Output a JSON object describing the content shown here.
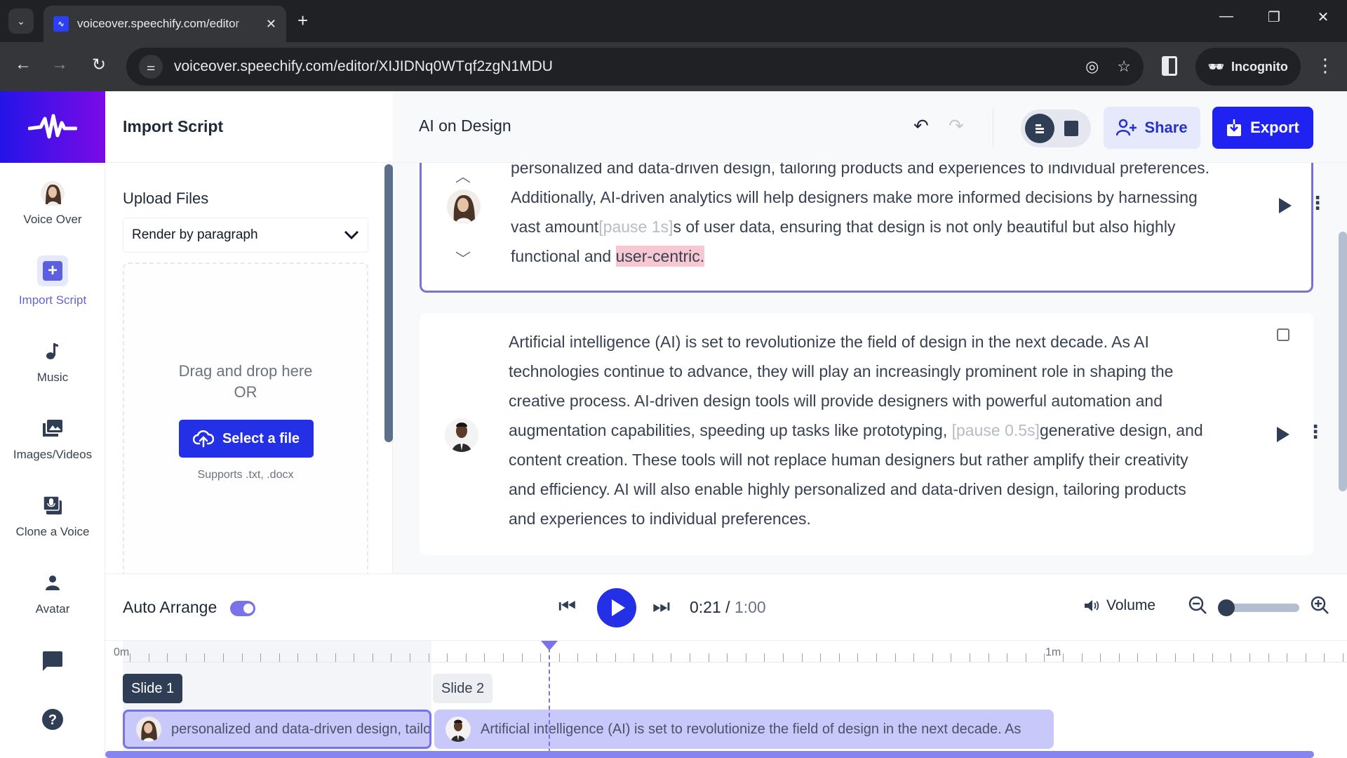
{
  "browser": {
    "tab_title": "voiceover.speechify.com/editor",
    "url": "voiceover.speechify.com/editor/XIJIDNq0WTqf2zgN1MDU",
    "profile_label": "Incognito",
    "icons": {
      "tab_search": "chevron-down-icon",
      "tab_close": "close-icon",
      "new_tab": "plus-icon",
      "back": "arrow-left-icon",
      "forward": "arrow-right-icon",
      "reload": "reload-icon",
      "site_info": "tune-icon",
      "tracking": "eye-off-icon",
      "bookmark": "star-icon",
      "side_panel": "side-panel-icon",
      "incognito": "incognito-icon",
      "menu": "more-vertical-icon"
    }
  },
  "sidebar": {
    "items": [
      {
        "label": "Voice Over",
        "icon": "voice-avatar-icon"
      },
      {
        "label": "Import Script",
        "icon": "plus-square-icon",
        "active": true
      },
      {
        "label": "Music",
        "icon": "music-note-icon"
      },
      {
        "label": "Images/Videos",
        "icon": "image-stack-icon"
      },
      {
        "label": "Clone a Voice",
        "icon": "mic-stack-icon"
      },
      {
        "label": "Avatar",
        "icon": "person-icon"
      }
    ],
    "bottom_icons": [
      "chat-icon",
      "help-icon"
    ]
  },
  "import_panel": {
    "title": "Import Script",
    "upload_title": "Upload Files",
    "render_mode": "Render by paragraph",
    "drop_text_line1": "Drag and drop here",
    "drop_text_line2": "OR",
    "select_button": "Select a file",
    "supports": "Supports .txt, .docx"
  },
  "editor": {
    "doc_title": "AI on Design",
    "share_label": "Share",
    "export_label": "Export",
    "blocks": [
      {
        "voice": "female",
        "text_before_pause": "personalized and data-driven design, tailoring products and experiences to individual preferences. Additionally, AI-driven analytics will help designers make more informed decisions by harnessing vast amount",
        "pause": "[pause 1s]",
        "text_after_pause": "s of user data, ensuring that design is not only beautiful but also highly functional and ",
        "highlighted": "user-centric."
      },
      {
        "voice": "male",
        "text_before_pause": "Artificial intelligence (AI) is set to revolutionize the field of design in the next decade. As AI technologies continue to advance, they will play an increasingly prominent role in shaping the creative process. AI-driven design tools will provide designers with powerful automation and augmentation capabilities, speeding up tasks like prototyping, ",
        "pause": "[pause 0.5s]",
        "text_after_pause": "generative design, and content creation. These tools will not replace human designers but rather amplify their creativity and efficiency. AI will also enable highly personalized and data-driven design, tailoring products and experiences to individual preferences."
      }
    ]
  },
  "player": {
    "auto_arrange_label": "Auto Arrange",
    "auto_arrange_on": true,
    "current_time": "0:21",
    "separator": " / ",
    "total_time": "1:00",
    "volume_label": "Volume",
    "zoom_level_fraction": 0.0
  },
  "timeline": {
    "start_label": "0m",
    "minute_label": "1m",
    "slides": [
      {
        "label": "Slide 1",
        "clip_text": "personalized and data-driven design, tailoring products and experiences to individual preferences."
      },
      {
        "label": "Slide 2",
        "clip_text": "Artificial intelligence (AI) is set to revolutionize the field of design in the next decade. As"
      }
    ]
  }
}
